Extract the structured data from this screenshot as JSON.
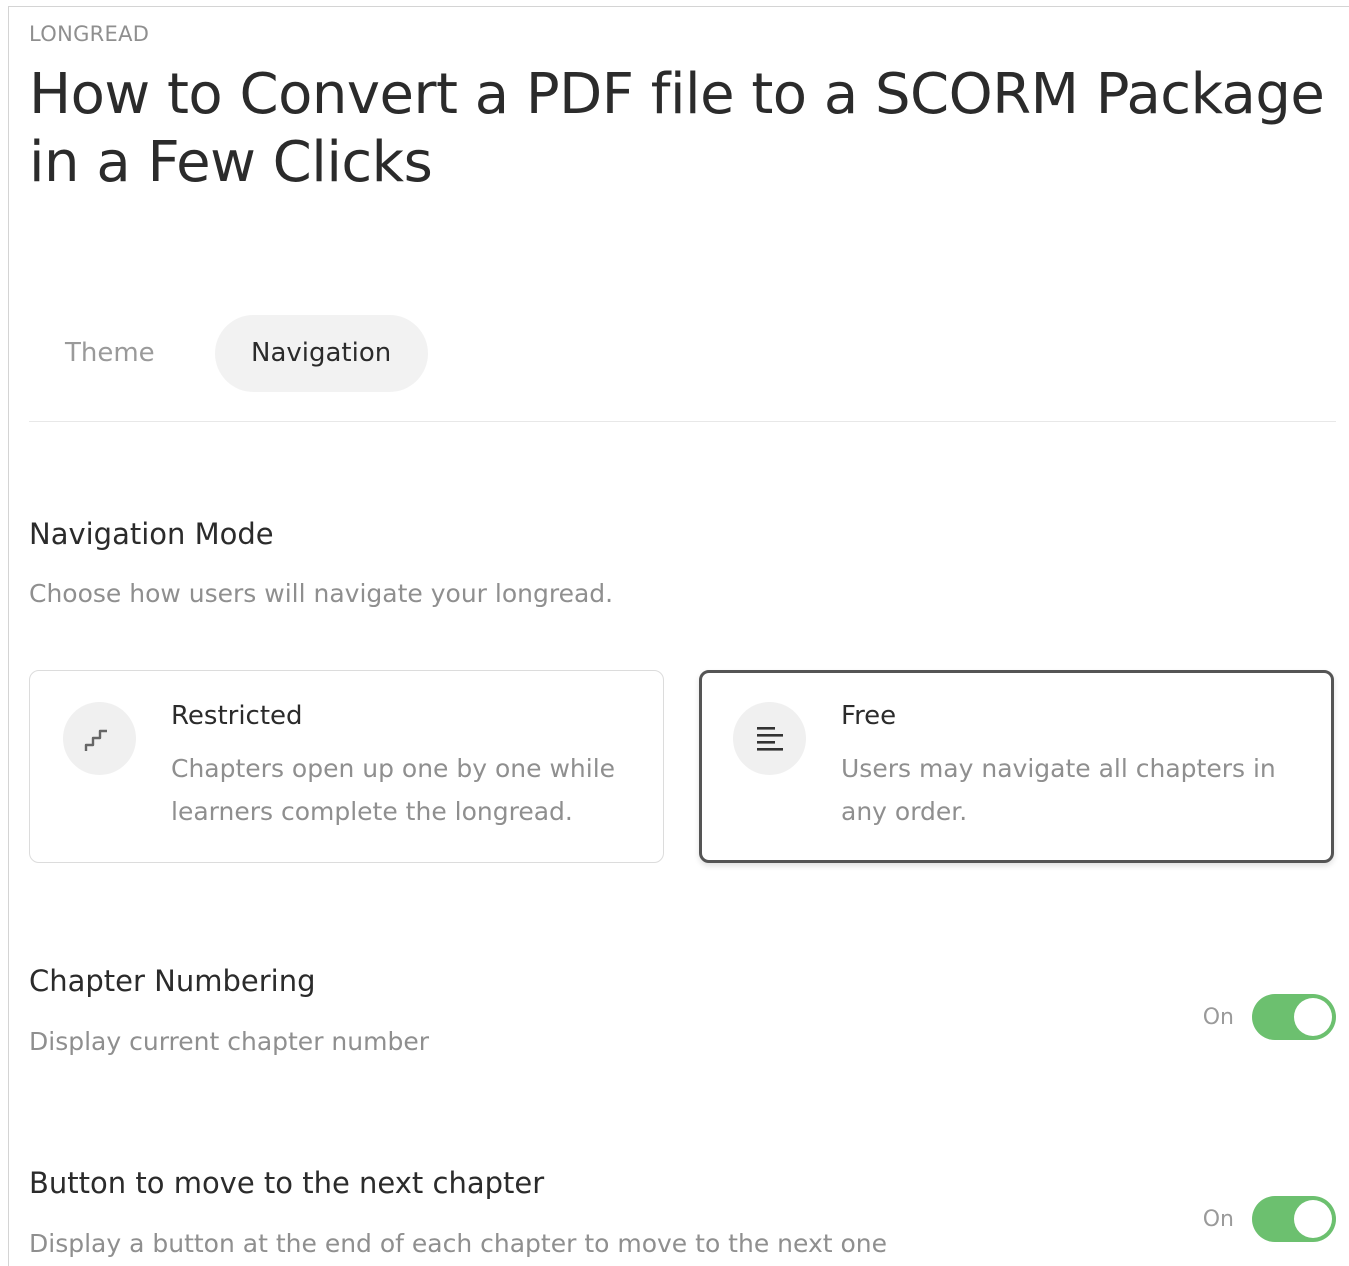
{
  "header": {
    "eyebrow": "LONGREAD",
    "title": "How to Convert a PDF file to a SCORM Package in a Few Clicks"
  },
  "tabs": [
    {
      "label": "Theme",
      "active": false
    },
    {
      "label": "Navigation",
      "active": true
    }
  ],
  "navigation_mode": {
    "title": "Navigation Mode",
    "description": "Choose how users will navigate your longread.",
    "options": [
      {
        "icon": "stairs-icon",
        "title": "Restricted",
        "description": "Chapters open up one by one while learners complete the longread.",
        "selected": false
      },
      {
        "icon": "align-left-icon",
        "title": "Free",
        "description": "Users may navigate all chapters in any order.",
        "selected": true
      }
    ]
  },
  "chapter_numbering": {
    "title": "Chapter Numbering",
    "description": "Display current chapter number",
    "toggle_label": "On",
    "enabled": true
  },
  "next_chapter_button": {
    "title": "Button to move to the next chapter",
    "description": "Display a button at the end of each chapter to move to the next one",
    "toggle_label": "On",
    "enabled": true
  },
  "colors": {
    "toggle_on": "#6cc06f",
    "selected_border": "#555555",
    "muted_text": "#8f8f8f"
  }
}
